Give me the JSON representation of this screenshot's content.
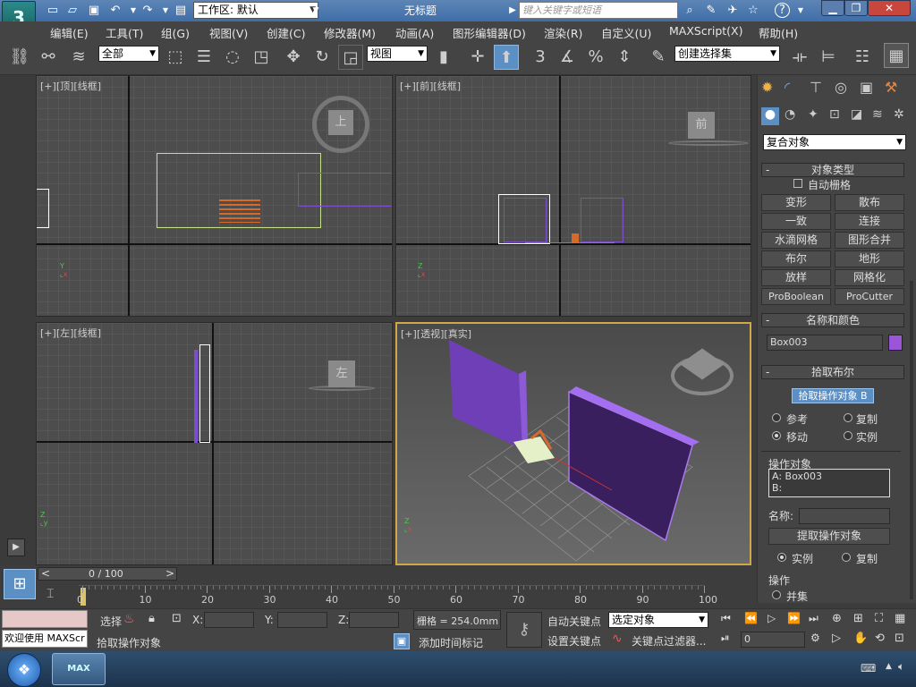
{
  "titlebar": {
    "workspace_label": "工作区: 默认",
    "doc_title": "无标题",
    "search_placeholder": "键入关键字或短语",
    "help_label": "?",
    "minimize": "▁",
    "restore": "❐",
    "close": "✕"
  },
  "logo": {
    "label": "3"
  },
  "menu": [
    "编辑(E)",
    "工具(T)",
    "组(G)",
    "视图(V)",
    "创建(C)",
    "修改器(M)",
    "动画(A)",
    "图形编辑器(D)",
    "渲染(R)",
    "自定义(U)",
    "MAXScript(X)",
    "帮助(H)"
  ],
  "toolbar": {
    "filter_value": "全部",
    "ref_coord_value": "视图",
    "selection_set_placeholder": "创建选择集",
    "snap_label": "3",
    "percent_label": "%"
  },
  "viewports": {
    "top": {
      "plus": "[+]",
      "name": "[顶]",
      "mode": "[线框]",
      "cube_label": "上"
    },
    "front": {
      "plus": "[+]",
      "name": "[前]",
      "mode": "[线框]",
      "cube_label": "前"
    },
    "left": {
      "plus": "[+]",
      "name": "[左]",
      "mode": "[线框]",
      "cube_label": "左"
    },
    "persp": {
      "plus": "[+]",
      "name": "[透视]",
      "mode": "[真实]"
    }
  },
  "command_panel": {
    "category_value": "复合对象",
    "object_type_title": "对象类型",
    "autogrid_label": "自动栅格",
    "buttons": [
      "变形",
      "散布",
      "一致",
      "连接",
      "水滴网格",
      "图形合并",
      "布尔",
      "地形",
      "放样",
      "网格化",
      "ProBoolean",
      "ProCutter"
    ],
    "name_color_title": "名称和颜色",
    "object_name": "Box003",
    "object_color": "#9a55d8",
    "pick_boolean_title": "拾取布尔",
    "pick_operand_b": "拾取操作对象 B",
    "radio_ref": "参考",
    "radio_copy": "复制",
    "radio_move": "移动",
    "radio_instance": "实例",
    "operands_title": "操作对象",
    "operand_a": "A: Box003",
    "operand_b": "B:",
    "name_label": "名称:",
    "extract_operand": "提取操作对象",
    "radio_instance2": "实例",
    "radio_copy2": "复制",
    "operation_title": "操作",
    "radio_union": "并集"
  },
  "timeline": {
    "frame_display": "0 / 100",
    "prev": "<",
    "next": ">",
    "ticks": [
      "0",
      "10",
      "20",
      "30",
      "40",
      "50",
      "60",
      "70",
      "80",
      "90",
      "100"
    ]
  },
  "status": {
    "welcome": "欢迎使用 MAXScr",
    "selected_label": "选择",
    "x_label": "X:",
    "y_label": "Y:",
    "z_label": "Z:",
    "grid_label": "栅格 = 254.0mm",
    "prompt": "拾取操作对象",
    "add_time_tag": "添加时间标记",
    "auto_key": "自动关键点",
    "set_key": "设置关键点",
    "key_mode_value": "选定对象",
    "key_filters": "关键点过滤器...",
    "frame_value": "0"
  },
  "taskbar": {
    "app_label": "MAX"
  }
}
